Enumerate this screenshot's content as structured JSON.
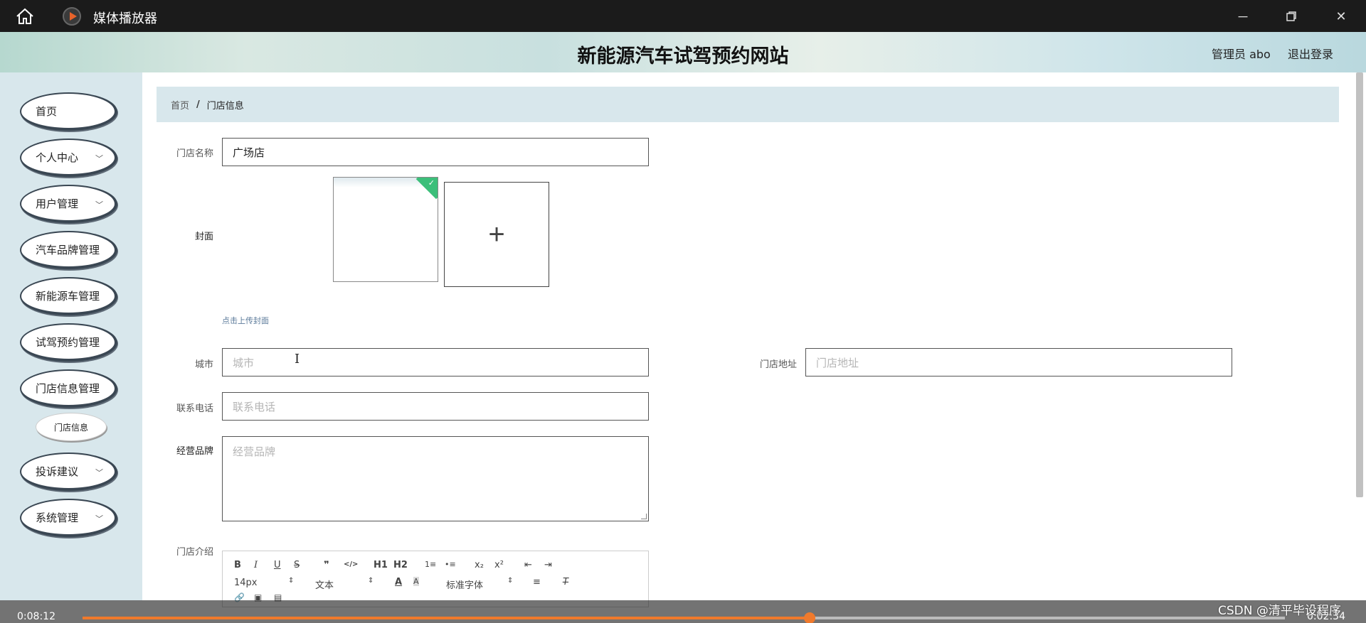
{
  "player": {
    "title": "媒体播放器",
    "elapsed": "0:08:12",
    "total": "0:02:34",
    "progress": 0.605,
    "watermark": "CSDN @清平毕设程序"
  },
  "header": {
    "site_title": "新能源汽车试驾预约网站",
    "user": "管理员 abo",
    "logout": "退出登录"
  },
  "sidebar": {
    "items": [
      {
        "label": "首页",
        "has_children": false
      },
      {
        "label": "个人中心",
        "has_children": true
      },
      {
        "label": "用户管理",
        "has_children": true
      },
      {
        "label": "汽车品牌管理",
        "has_children": false
      },
      {
        "label": "新能源车管理",
        "has_children": false
      },
      {
        "label": "试驾预约管理",
        "has_children": false
      },
      {
        "label": "门店信息管理",
        "has_children": false
      },
      {
        "label": "投诉建议",
        "has_children": true
      },
      {
        "label": "系统管理",
        "has_children": true
      }
    ],
    "sub_item": "门店信息"
  },
  "breadcrumb": {
    "home": "首页",
    "separator": "/",
    "current": "门店信息"
  },
  "form": {
    "store_name": {
      "label": "门店名称",
      "value": "广场店"
    },
    "cover": {
      "label": "封面",
      "hint": "点击上传封面",
      "add_symbol": "+"
    },
    "city": {
      "label": "城市",
      "placeholder": "城市"
    },
    "address": {
      "label": "门店地址",
      "placeholder": "门店地址"
    },
    "phone": {
      "label": "联系电话",
      "placeholder": "联系电话"
    },
    "brands": {
      "label": "经营品牌",
      "placeholder": "经营品牌"
    },
    "intro": {
      "label": "门店介绍"
    }
  },
  "editor_toolbar": {
    "row1": [
      "B",
      "I",
      "U",
      "S",
      "❞",
      "</>",
      "H1",
      "H2",
      "1≡",
      "•≡",
      "x₂",
      "x²",
      "⇤",
      "⇥"
    ],
    "font_size": "14px",
    "block_type": "文本",
    "font_family": "标准字体"
  }
}
